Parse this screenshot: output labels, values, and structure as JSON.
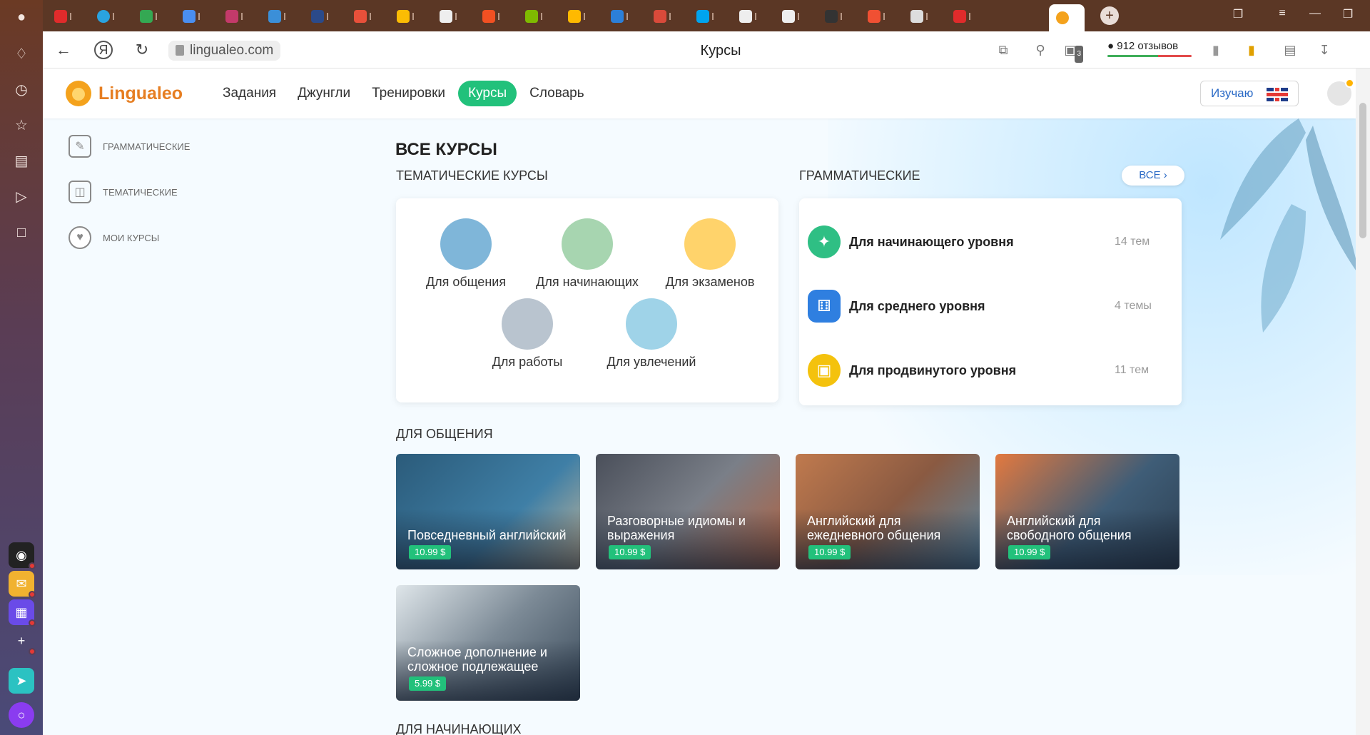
{
  "browser": {
    "url": "lingualeo.com",
    "title": "Курсы",
    "reviews": "912 отзывов",
    "tab_count": "3"
  },
  "header": {
    "logo": "Lingualeo",
    "nav": [
      {
        "label": "Задания",
        "active": false
      },
      {
        "label": "Джунгли",
        "active": false
      },
      {
        "label": "Тренировки",
        "active": false
      },
      {
        "label": "Курсы",
        "active": true
      },
      {
        "label": "Словарь",
        "active": false
      }
    ],
    "study_label": "Изучаю",
    "study_language_flag": "uk-flag-icon"
  },
  "filters": [
    {
      "label": "ГРАММАТИЧЕСКИЕ",
      "icon": "pen-icon"
    },
    {
      "label": "ТЕМАТИЧЕСКИЕ",
      "icon": "book-icon"
    },
    {
      "label": "МОИ КУРСЫ",
      "icon": "heart-icon"
    }
  ],
  "all_courses": {
    "title": "ВСЕ КУРСЫ",
    "thematic_title": "ТЕМАТИЧЕСКИЕ КУРСЫ",
    "thematic": [
      {
        "label": "Для общения",
        "color": "#7fb6d9"
      },
      {
        "label": "Для начинающих",
        "color": "#a7d5b0"
      },
      {
        "label": "Для экзаменов",
        "color": "#ffd36b"
      },
      {
        "label": "Для работы",
        "color": "#b9c4cf"
      },
      {
        "label": "Для увлечений",
        "color": "#9fd3e8"
      }
    ],
    "grammar_title": "ГРАММАТИЧЕСКИЕ",
    "all_button": "ВСЕ",
    "grammar": [
      {
        "name": "Для начинающего уровня",
        "count": "14 тем",
        "color": "#2fbf84",
        "icon": "puzzle-icon"
      },
      {
        "name": "Для среднего уровня",
        "count": "4 темы",
        "color": "#2f7fe0",
        "icon": "dice-icon"
      },
      {
        "name": "Для продвинутого уровня",
        "count": "11 тем",
        "color": "#f4c20d",
        "icon": "briefcase-icon"
      }
    ]
  },
  "communication": {
    "title": "ДЛЯ ОБЩЕНИЯ",
    "courses": [
      {
        "title": "Повседневный английский",
        "price": "10.99 $",
        "color": "#2b5b7a"
      },
      {
        "title": "Разговорные идиомы и выражения",
        "price": "10.99 $",
        "color": "#4a4f5a"
      },
      {
        "title": "Английский для ежедневного общения",
        "price": "10.99 $",
        "color": "#c07a4e"
      },
      {
        "title": "Английский для свободного общения",
        "price": "10.99 $",
        "color": "#3f5d77"
      },
      {
        "title": "Сложное дополнение и сложное подлежащее",
        "price": "5.99 $",
        "color": "#7c8a96"
      }
    ]
  },
  "next_section": "ДЛЯ НАЧИНАЮЩИХ"
}
